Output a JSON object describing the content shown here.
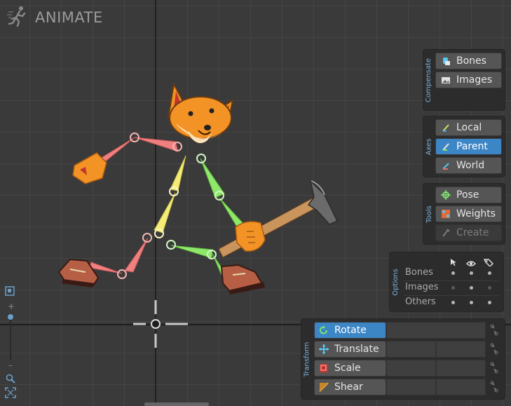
{
  "app": {
    "mode_title": "ANIMATE"
  },
  "compensate": {
    "title": "Compensate",
    "bones_label": "Bones",
    "images_label": "Images"
  },
  "axes": {
    "title": "Axes",
    "local_label": "Local",
    "parent_label": "Parent",
    "world_label": "World",
    "selected": "Parent"
  },
  "tools": {
    "title": "Tools",
    "pose_label": "Pose",
    "weights_label": "Weights",
    "create_label": "Create"
  },
  "options": {
    "title": "Options",
    "rows": [
      {
        "label": "Bones",
        "select": true,
        "visible": true,
        "lock": true
      },
      {
        "label": "Images",
        "select": false,
        "visible": true,
        "lock": false
      },
      {
        "label": "Others",
        "select": true,
        "visible": true,
        "lock": true
      }
    ]
  },
  "transform": {
    "title": "Transform",
    "rotate_label": "Rotate",
    "translate_label": "Translate",
    "scale_label": "Scale",
    "shear_label": "Shear",
    "selected": "Rotate"
  },
  "zoom": {
    "plus": "+",
    "minus": "–"
  },
  "colors": {
    "accent": "#3d86c6",
    "bone_green": "#8ee86a",
    "bone_yellow": "#f5ec78",
    "bone_red": "#f07676",
    "fox_orange": "#f39325"
  }
}
